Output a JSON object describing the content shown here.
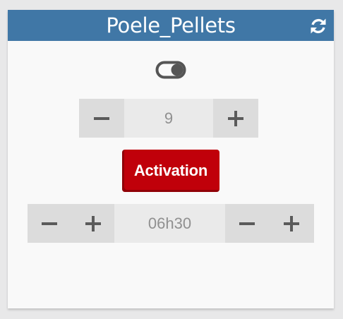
{
  "widget": {
    "title": "Poele_Pellets",
    "header_color": "#4077a6",
    "refresh_icon": "refresh-icon",
    "toggle_icon": "toggle-on-icon"
  },
  "power_stepper": {
    "value": "9",
    "minus_icon": "minus-icon",
    "plus_icon": "plus-icon"
  },
  "activation_button": {
    "label": "Activation",
    "color": "#c0000a"
  },
  "time_stepper": {
    "value": "06h30",
    "hours_minus_icon": "minus-icon",
    "hours_plus_icon": "plus-icon",
    "minutes_minus_icon": "minus-icon",
    "minutes_plus_icon": "plus-icon"
  }
}
